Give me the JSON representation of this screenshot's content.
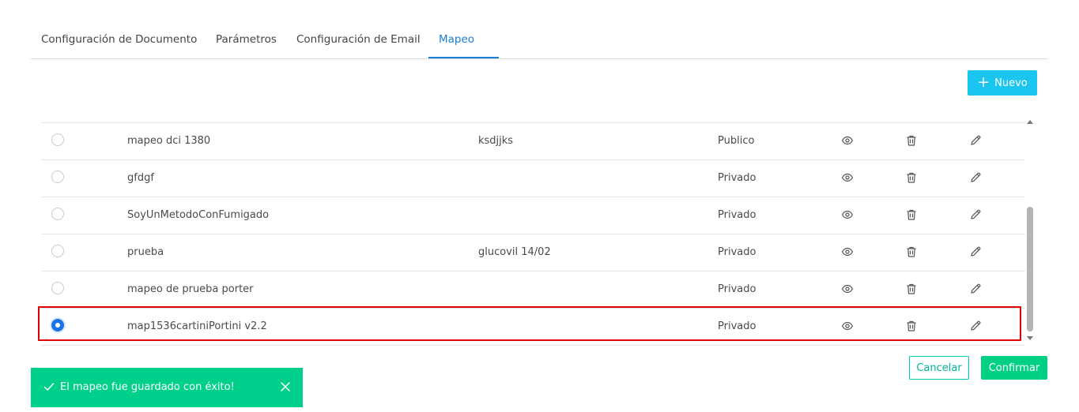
{
  "tabs": [
    {
      "label": "Configuración de Documento",
      "active": false
    },
    {
      "label": "Parámetros",
      "active": false
    },
    {
      "label": "Configuración de Email",
      "active": false
    },
    {
      "label": "Mapeo",
      "active": true
    }
  ],
  "toolbar": {
    "new_label": "Nuevo",
    "new_icon": "plus-icon"
  },
  "table": {
    "rows": [
      {
        "name": "mapeo dci 1380",
        "description": "ksdjjks",
        "visibility": "Publico",
        "selected": false
      },
      {
        "name": "gfdgf",
        "description": "",
        "visibility": "Privado",
        "selected": false
      },
      {
        "name": "SoyUnMetodoConFumigado",
        "description": "",
        "visibility": "Privado",
        "selected": false
      },
      {
        "name": "prueba",
        "description": "glucovil 14/02",
        "visibility": "Privado",
        "selected": false
      },
      {
        "name": "mapeo de prueba porter",
        "description": "",
        "visibility": "Privado",
        "selected": false
      },
      {
        "name": "map1536cartiniPortini v2.2",
        "description": "",
        "visibility": "Privado",
        "selected": true
      }
    ],
    "row_actions": [
      "eye-icon",
      "trash-icon",
      "pencil-icon"
    ]
  },
  "footer": {
    "cancel_label": "Cancelar",
    "confirm_label": "Confirmar"
  },
  "toast": {
    "message": "El mapeo fue guardado con éxito!"
  },
  "colors": {
    "accent": "#1a7ed6",
    "new_button": "#1ac6f0",
    "confirm": "#00d084",
    "toast": "#00d08c",
    "highlight": "#e00000"
  }
}
